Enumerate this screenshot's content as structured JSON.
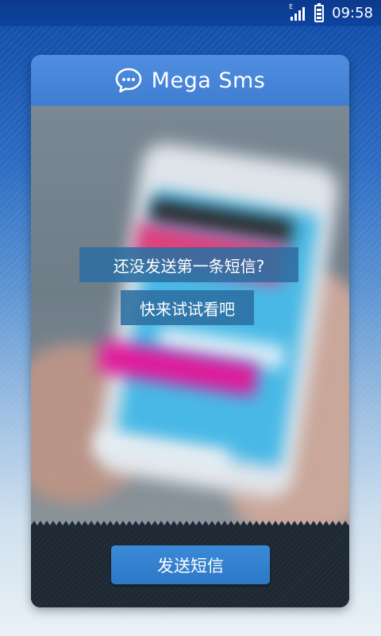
{
  "status_bar": {
    "network_type": "E",
    "time": "09:58",
    "icons": [
      "signal-icon",
      "battery-icon"
    ]
  },
  "app": {
    "title": "Mega Sms",
    "logo_icon": "chat-bubble-icon"
  },
  "hero": {
    "prompt_line1": "还没发送第一条短信?",
    "prompt_line2": "快来试试看吧"
  },
  "footer": {
    "send_button_label": "发送短信"
  },
  "colors": {
    "header_blue": "#4a88dc",
    "button_blue": "#3382d0",
    "footer_dark": "#202a35",
    "prompt_bg": "#2c6ea0"
  }
}
